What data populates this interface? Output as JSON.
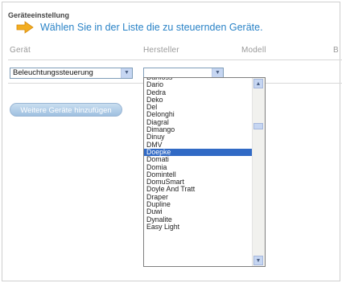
{
  "section": {
    "title": "Geräteeinstellung"
  },
  "hint": {
    "icon": "arrow-right-icon",
    "text": "Wählen Sie in der Liste die zu steuernden Geräte."
  },
  "columns": {
    "geraet": "Gerät",
    "hersteller": "Hersteller",
    "modell": "Modell",
    "extra": "B"
  },
  "row": {
    "geraet_value": "Beleuchtungssteuerung",
    "hersteller_value": ""
  },
  "add_button_label": "Weitere Geräte hinzufügen",
  "manufacturers": [
    "Danfoss",
    "Dario",
    "Dedra",
    "Deko",
    "Del",
    "Delonghi",
    "Diagral",
    "Dimango",
    "Dinuy",
    "DMV",
    "Doepke",
    "Domati",
    "Domia",
    "Domintell",
    "DomuSmart",
    "Doyle And Tratt",
    "Draper",
    "Dupline",
    "Duwi",
    "Dynalite",
    "Easy Light"
  ],
  "selected_manufacturer": "Doepke",
  "colors": {
    "accent": "#2a83c7",
    "selection": "#316ac5"
  }
}
